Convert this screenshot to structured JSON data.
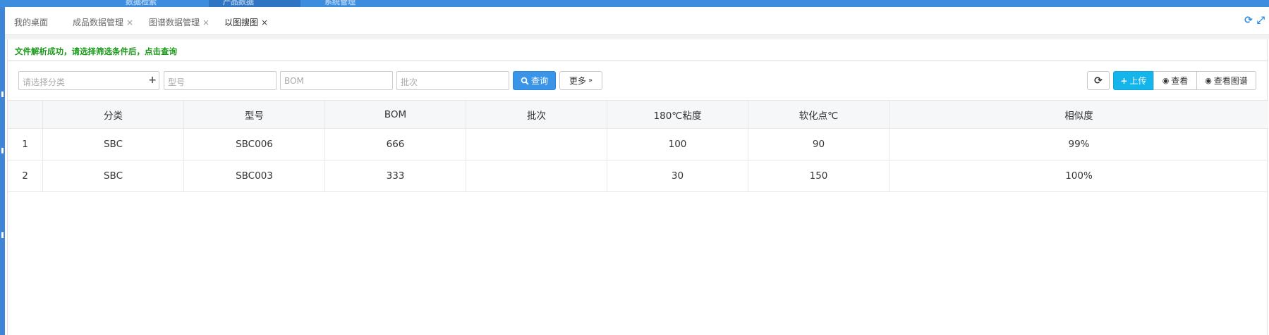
{
  "topbar": {
    "ghost_items": [
      "数据检索",
      "产品数据",
      "系统管理"
    ]
  },
  "tabs": [
    {
      "label": "我的桌面",
      "closable": false,
      "active": false
    },
    {
      "label": "成品数据管理",
      "closable": true,
      "active": false
    },
    {
      "label": "图谱数据管理",
      "closable": true,
      "active": false
    },
    {
      "label": "以图搜图",
      "closable": true,
      "active": true
    }
  ],
  "tab_tools": {
    "refresh_icon": "refresh-icon",
    "fullscreen_icon": "expand-icon"
  },
  "message": "文件解析成功，请选择筛选条件后，点击查询",
  "filters": {
    "category_placeholder": "请选择分类",
    "model_placeholder": "型号",
    "bom_placeholder": "BOM",
    "batch_placeholder": "批次",
    "query_label": "查询",
    "more_label": "更多"
  },
  "actions": {
    "upload_label": "上传",
    "view_label": "查看",
    "view_spectrum_label": "查看图谱"
  },
  "table": {
    "columns": [
      "",
      "分类",
      "型号",
      "BOM",
      "批次",
      "180℃粘度",
      "软化点℃",
      "相似度"
    ],
    "rows": [
      [
        "1",
        "SBC",
        "SBC006",
        "666",
        "",
        "100",
        "90",
        "99%"
      ],
      [
        "2",
        "SBC",
        "SBC003",
        "333",
        "",
        "30",
        "150",
        "100%"
      ]
    ]
  },
  "colors": {
    "accent": "#3a94e8",
    "info": "#13b5ea",
    "success_text": "#1a9a1a"
  }
}
